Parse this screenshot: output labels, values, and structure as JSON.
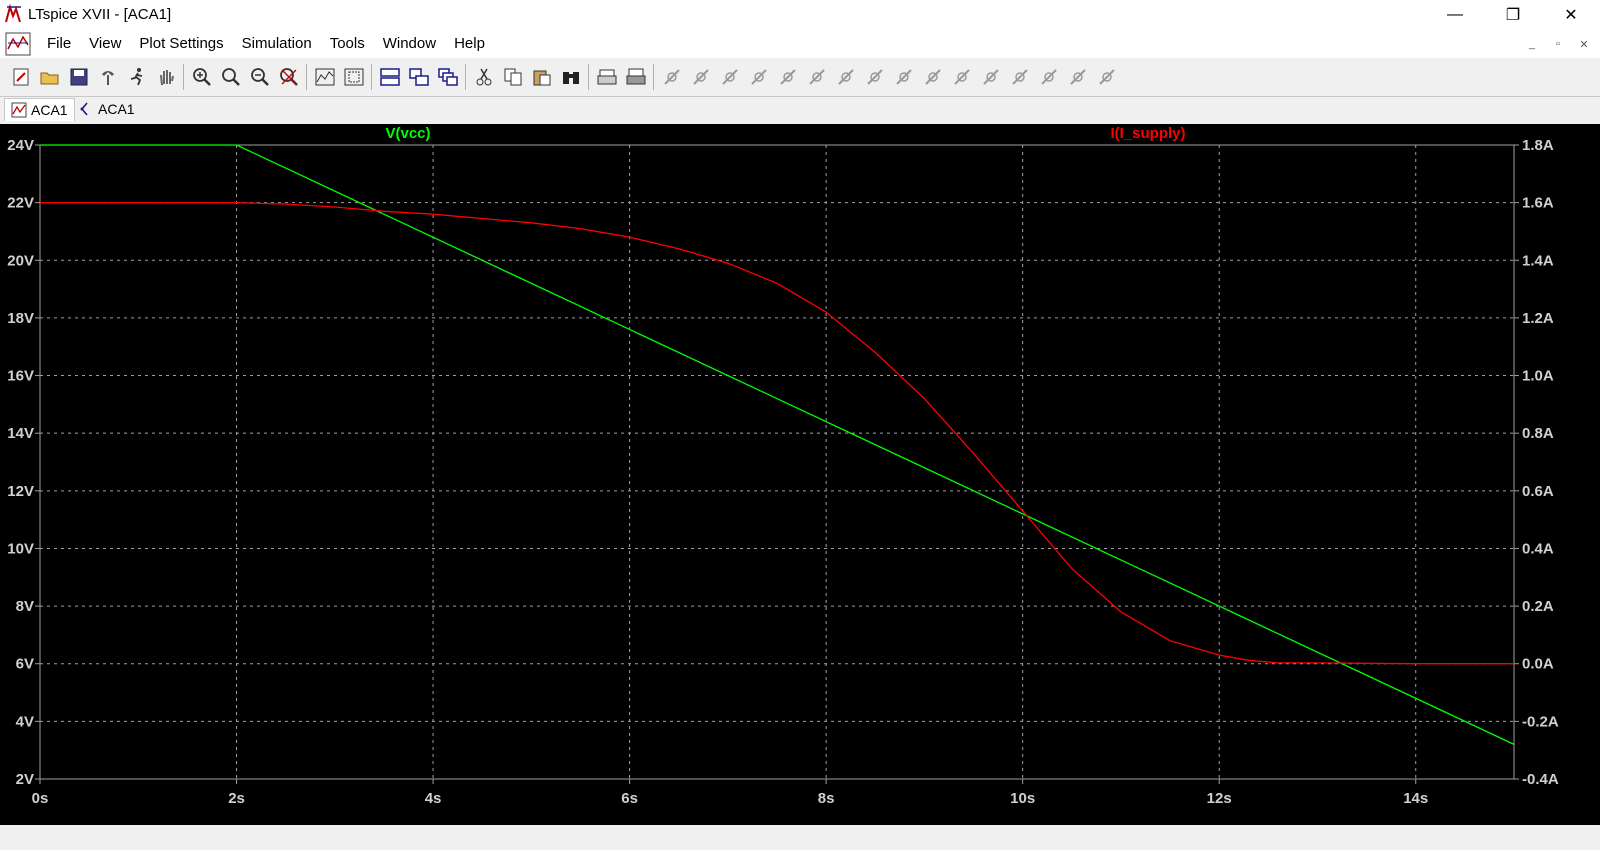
{
  "window": {
    "title": "LTspice XVII - [ACA1]",
    "minimize": "—",
    "restore": "❐",
    "close": "✕"
  },
  "menu": [
    "File",
    "View",
    "Plot Settings",
    "Simulation",
    "Tools",
    "Window",
    "Help"
  ],
  "mdi": {
    "minimize": "_",
    "restore": "▫",
    "close": "✕"
  },
  "toolbar_icons": [
    "new-schematic-icon",
    "open-icon",
    "save-icon",
    "control-panel-icon",
    "run-icon",
    "halt-icon",
    "zoom-in-icon",
    "zoom-pan-icon",
    "zoom-out-icon",
    "zoom-fit-icon",
    "autorange-icon",
    "zoom-rect-icon",
    "tile-horizontal-icon",
    "tile-vertical-icon",
    "cascade-icon",
    "cut-icon",
    "copy-icon",
    "paste-icon",
    "find-icon",
    "print-preview-icon",
    "print-icon",
    "wire-icon",
    "ground-icon",
    "label-icon",
    "resistor-icon",
    "capacitor-icon",
    "inductor-icon",
    "diode-icon",
    "component-icon",
    "move-icon",
    "drag-icon",
    "undo-icon",
    "redo-icon",
    "rotate-icon",
    "mirror-icon",
    "text-icon",
    "spice-directive-icon"
  ],
  "tabs": [
    {
      "label": "ACA1",
      "kind": "waveform",
      "active": true
    },
    {
      "label": "ACA1",
      "kind": "schematic",
      "active": false
    }
  ],
  "colors": {
    "background": "#000000",
    "grid": "#a0a0a0",
    "axis_text": "#d0d0d0",
    "vcc": "#00ff00",
    "i_supply": "#ff0000"
  },
  "chart_data": {
    "type": "line",
    "title": "",
    "xlabel": "",
    "ylabel_left": "",
    "ylabel_right": "",
    "xlim": [
      0,
      15
    ],
    "ylim_left": [
      2,
      24
    ],
    "ylim_right": [
      -0.4,
      1.8
    ],
    "x_ticks": [
      "0s",
      "2s",
      "4s",
      "6s",
      "8s",
      "10s",
      "12s",
      "14s"
    ],
    "y_left_ticks": [
      "2V",
      "4V",
      "6V",
      "8V",
      "10V",
      "12V",
      "14V",
      "16V",
      "18V",
      "20V",
      "22V",
      "24V"
    ],
    "y_right_ticks": [
      "-0.4A",
      "-0.2A",
      "0.0A",
      "0.2A",
      "0.4A",
      "0.6A",
      "0.8A",
      "1.0A",
      "1.2A",
      "1.4A",
      "1.6A",
      "1.8A"
    ],
    "grid": true,
    "legend": "top",
    "series": [
      {
        "name": "V(vcc)",
        "axis": "left",
        "color": "#00ff00",
        "x": [
          0,
          2,
          15
        ],
        "y": [
          24,
          24,
          3.2
        ]
      },
      {
        "name": "I(I_supply)",
        "axis": "right",
        "color": "#ff0000",
        "x": [
          0,
          1,
          2,
          2.5,
          3,
          3.5,
          4,
          4.5,
          5,
          5.5,
          6,
          6.5,
          7,
          7.5,
          8,
          8.5,
          9,
          9.5,
          10,
          10.5,
          11,
          11.5,
          12,
          12.3,
          12.6,
          13,
          14,
          15
        ],
        "y": [
          1.6,
          1.6,
          1.6,
          1.595,
          1.585,
          1.57,
          1.56,
          1.545,
          1.53,
          1.51,
          1.48,
          1.44,
          1.39,
          1.32,
          1.22,
          1.08,
          0.92,
          0.73,
          0.53,
          0.33,
          0.18,
          0.08,
          0.03,
          0.012,
          0.003,
          0.003,
          0.0,
          0.0
        ]
      }
    ]
  }
}
